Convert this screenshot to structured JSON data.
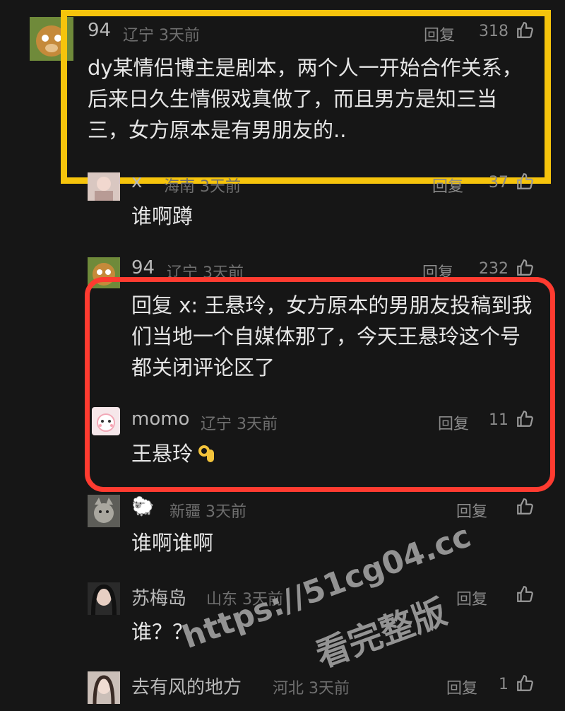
{
  "comments": [
    {
      "user": "94",
      "region": "辽宁",
      "time": "3天前",
      "reply": "回复",
      "likes": "318",
      "text": "dy某情侣博主是剧本，两个人一开始合作关系，后来日久生情假戏真做了，而且男方是知三当三，女方原本是有男朋友的.."
    },
    {
      "user": "x",
      "region": "海南",
      "time": "3天前",
      "reply": "回复",
      "likes": "37",
      "text": "谁啊蹲"
    },
    {
      "user": "94",
      "region": "辽宁",
      "time": "3天前",
      "reply": "回复",
      "likes": "232",
      "text": "回复 x: 王悬玲，女方原本的男朋友投稿到我们当地一个自媒体那了，今天王悬玲这个号都关闭评论区了"
    },
    {
      "user": "momo",
      "region": "辽宁",
      "time": "3天前",
      "reply": "回复",
      "likes": "11",
      "text": "王悬玲"
    },
    {
      "user": "🐑",
      "region": "新疆",
      "time": "3天前",
      "reply": "回复",
      "likes": "",
      "text": "谁啊谁啊"
    },
    {
      "user": "苏梅岛",
      "region": "山东",
      "time": "3天前",
      "reply": "回复",
      "likes": "",
      "text": "谁？？"
    },
    {
      "user": "去有风的地方",
      "region": "河北",
      "time": "3天前",
      "reply": "回复",
      "likes": "1",
      "text": ""
    }
  ],
  "watermark": {
    "line1": "https://51cg04.cc",
    "line2": "看完整版"
  },
  "colors": {
    "highlight_yellow": "#f6c40c",
    "highlight_red": "#ff3b30",
    "background": "#161616"
  }
}
